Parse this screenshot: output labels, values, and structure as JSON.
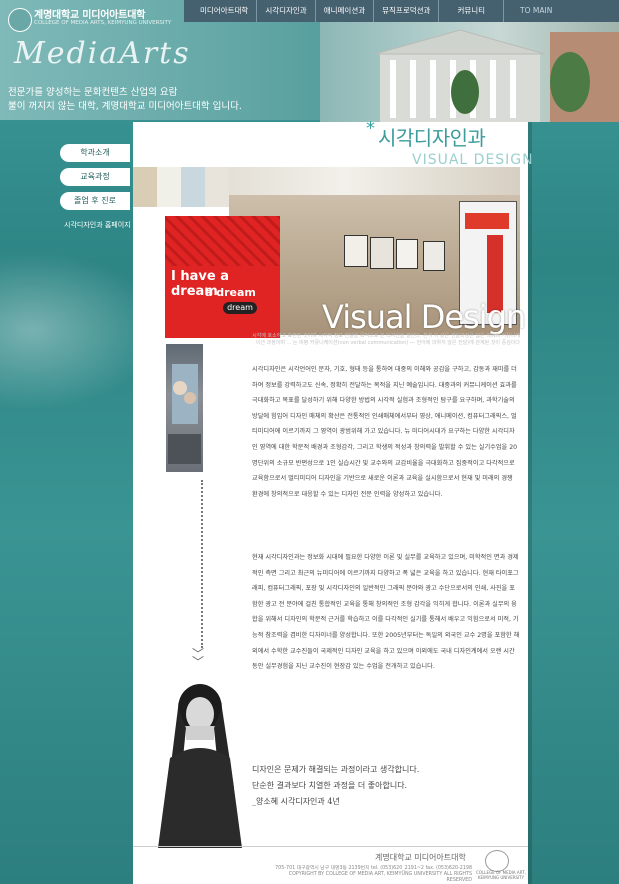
{
  "header": {
    "college_name": "계명대학교 미디어아트대학",
    "college_name_en": "COLLEGE OF MEDIA ARTS, KEIMYUNG UNIVERSITY",
    "brand": "MediaArts",
    "slogan_line1": "전문가를 양성하는 문화컨텐츠 산업의 요람",
    "slogan_line2": "불이 꺼지지 않는 대학, 계명대학교 미디어아트대학 입니다."
  },
  "nav": {
    "items": [
      "미디어아트대학",
      "시각디자인과",
      "애니메이션과",
      "뮤직프로덕션과",
      "커뮤니티",
      "TO MAIN"
    ]
  },
  "side_menu": {
    "items": [
      "학과소개",
      "교육과정",
      "졸업 후 진로",
      "시각디자인과 홈페이지"
    ]
  },
  "page": {
    "star": "*",
    "title": "시각디자인과",
    "title_en": "VISUAL DESIGN",
    "hero_text": "Visual Design",
    "caption": "시각에 호소하고 표현된 것이며 시각적 정보 전달을 목적으로 한 디자인을 말한다. 흔히 이 같은 전달과정은 넓은 의미의 커뮤니케이션 과정이며 ... 는 비평 커뮤니케이션(non verbal communication) — 언어에 의하지 않은 전달)에 관계된 것이 중심이다"
  },
  "poster": {
    "line1": "I have a dream",
    "line2": "a dream",
    "pill": "dream"
  },
  "body": {
    "para1": "시각디자인은 시각언어인 문자, 기호, 형태 등을 통하여 대중의 이해와 공감을 구하고, 감동과 재미를 더하여 정보를 강력하고도 신속, 정확히 전달하는 목적을 지닌 예술입니다. 대중과의 커뮤니케이션 효과를 극대화하고 목표를 달성하기 위해 다양한 방법의 시각적 실험과 조형적인 탐구를 요구하며, 과학기술의 방달에 힘입어 디자인 매체의 확산은 전통적인 인쇄매체에서부터 영상, 애니메이션, 컴퓨터그래픽스, 멀티미디어에 이르기까지 그 영역이 광범위해 가고 있습니다. 뉴 미디어시대가 요구하는 다양한 시각디자인 영역에 대한 학문적 배경과 조형감각, 그리고 학생의 적성과 창의력을 발휘할 수 있는 실기수업을 20명단위의 소규모 반편성으로 1인 실습시간 및 교수와의 교감비율을 극대화하고 집중적이고 다각적으로 교육함으로서 멀티미디어 디자인을 기반으로 새로운 이론과 교육을 실시함으로서 현재 및 미래의 경쟁 환경에 창의적으로 대응할 수 있는 디자인 전문 인력을 양성하고 있습니다.",
    "para2": "현재 시각디자인과는 정보화 시대에 필요한 다양한 이론 및 실무를 교육하고 있으며, 미학적인 면과 경제적인 측면 그리고 최근의 뉴미디어에 이르기까지 다양하고 폭 넓은 교육을 하고 있습니다. 현재 타이포그래피, 컴퓨터그래픽, 포장 및 시각디자인의 일반적인 그래픽 분야와 광고 수단으로서의 인쇄, 사진을 포함한 광고 전 분야에 걸친 통합적인 교육을 통해 창의적인 조형 감각을 익히게 합니다. 이론과 실무의 융합을 위해서 디자인의 학문적 근거를 학습하고 이를 다각적인 실기를 통해서 배우고 익힘으로서 미적, 기능적 참조력을 겸비한 디자이너를 양성합니다. 또한 2005년부터는 독일의 외국인 교수 2명을 포함한 해외에서 수학한 교수진들이 국제적인 디자인 교육을 하고 있으며 이외에도 국내 디자인계에서 오랜 시간동안 실무경험을 지닌 교수진이 현장감 있는 수업을 전개하고 있습니다."
  },
  "quote": {
    "line1": "디자인은 문제가 해결되는 과정이라고 생각합니다.",
    "line2": "단순한 결과보다 치열한 과정을 더 좋아합니다.",
    "line3": "_양소혜 시각디자인과 4년"
  },
  "footer": {
    "name": "계명대학교 미디어아트대학",
    "address": "705-701 대구광역시 남구 대명3동 2139번지 tel. (053)620_2191~2   fax. (053)620-2198",
    "copyright": "COPYRIGHT BY COLLEGE OF MEDIA ART, KEIMYUNG UNIVERSITY ALL RIGHTS RESERVED",
    "seal_text": "COLLEGE OF MEDIA ART, KEIMYUNG UNIVERSITY"
  },
  "colors": {
    "teal": "#3a9c9b",
    "nav_bg": "#45606f",
    "poster_red": "#e02424"
  }
}
